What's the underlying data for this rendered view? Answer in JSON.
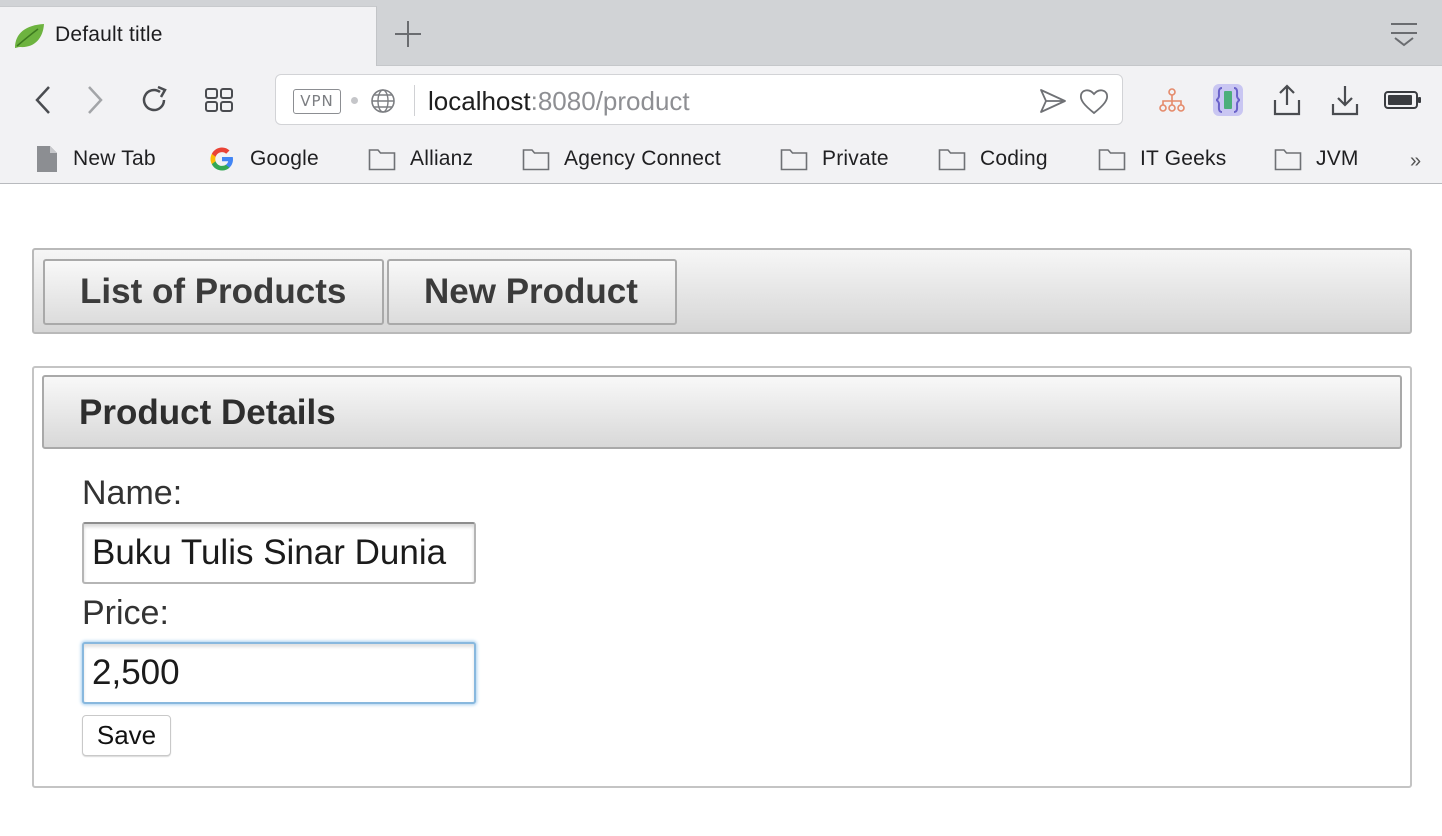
{
  "browser": {
    "tab_title": "Default title",
    "address": {
      "vpn_label": "VPN",
      "url_host": "localhost",
      "url_rest": ":8080/product"
    },
    "bookmarks": [
      {
        "label": "New Tab",
        "icon": "page-icon"
      },
      {
        "label": "Google",
        "icon": "google-icon"
      },
      {
        "label": "Allianz",
        "icon": "folder-icon"
      },
      {
        "label": "Agency Connect",
        "icon": "folder-icon"
      },
      {
        "label": "Private",
        "icon": "folder-icon"
      },
      {
        "label": "Coding",
        "icon": "folder-icon"
      },
      {
        "label": "IT Geeks",
        "icon": "folder-icon"
      },
      {
        "label": "JVM",
        "icon": "folder-icon"
      }
    ],
    "bookmarks_more": "»"
  },
  "menu": {
    "list_products_label": "List of Products",
    "new_product_label": "New Product"
  },
  "product_form": {
    "title": "Product Details",
    "name_label": "Name:",
    "name_value": "Buku Tulis Sinar Dunia",
    "price_label": "Price:",
    "price_value": "2,500",
    "save_label": "Save"
  },
  "colors": {
    "focus_ring": "#88b8de",
    "panel_border": "#b9b9b9"
  }
}
